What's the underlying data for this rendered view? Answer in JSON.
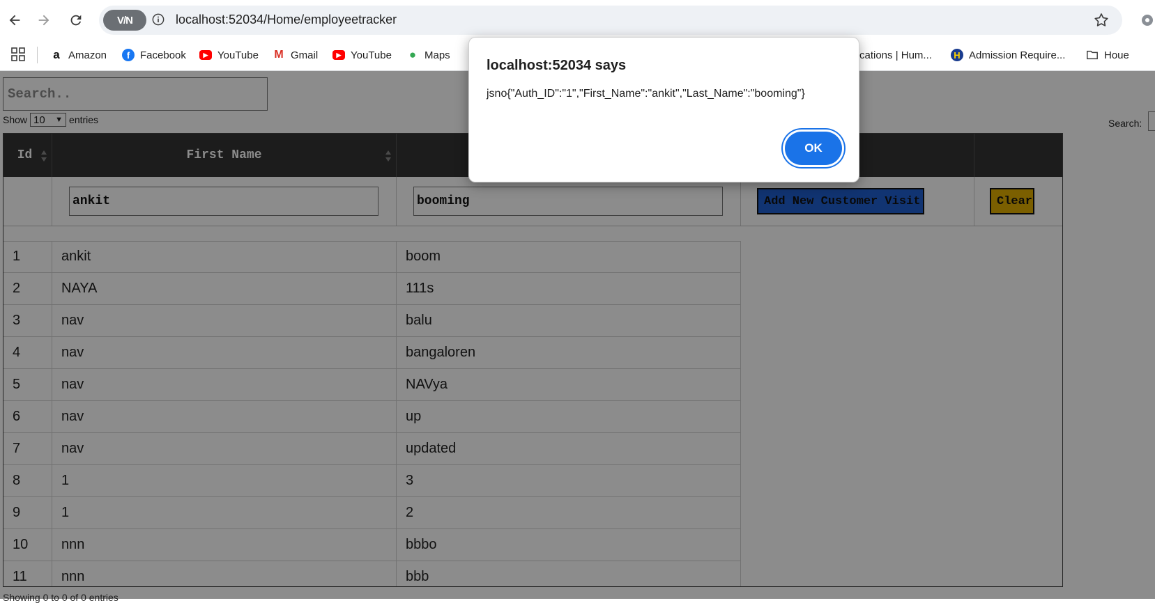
{
  "browser": {
    "vpn_label": "V/N",
    "url": "localhost:52034/Home/employeetracker"
  },
  "bookmarks": [
    {
      "label": "Amazon",
      "icon": "amazon-icon"
    },
    {
      "label": "Facebook",
      "icon": "facebook-icon"
    },
    {
      "label": "YouTube",
      "icon": "youtube-icon"
    },
    {
      "label": "Gmail",
      "icon": "gmail-icon"
    },
    {
      "label": "YouTube",
      "icon": "youtube-icon"
    },
    {
      "label": "Maps",
      "icon": "maps-icon"
    },
    {
      "label": "cations | Hum...",
      "icon": ""
    },
    {
      "label": "Admission Require...",
      "icon": "site-icon"
    },
    {
      "label": "Houe",
      "icon": "folder-icon"
    }
  ],
  "page": {
    "search_placeholder": "Search..",
    "show_label": "Show",
    "entries_value": "10",
    "entries_label": "entries",
    "dt_search_label": "Search:",
    "footer_info": "Showing 0 to 0 of 0 entries"
  },
  "table": {
    "headers": {
      "id": "Id",
      "first_name": "First Name"
    },
    "filter": {
      "first_name_value": "ankit",
      "last_name_value": "booming",
      "add_button": "Add New Customer Visit",
      "clear_button": "Clear"
    },
    "rows": [
      {
        "id": "1",
        "first": "ankit",
        "last": "boom"
      },
      {
        "id": "2",
        "first": "NAYA",
        "last": "111s"
      },
      {
        "id": "3",
        "first": "nav",
        "last": "balu"
      },
      {
        "id": "4",
        "first": "nav",
        "last": "bangaloren"
      },
      {
        "id": "5",
        "first": "nav",
        "last": "NAVya"
      },
      {
        "id": "6",
        "first": "nav",
        "last": "up"
      },
      {
        "id": "7",
        "first": "nav",
        "last": "updated"
      },
      {
        "id": "8",
        "first": "1",
        "last": "3"
      },
      {
        "id": "9",
        "first": "1",
        "last": "2"
      },
      {
        "id": "10",
        "first": "nnn",
        "last": "bbbo"
      },
      {
        "id": "11",
        "first": "nnn",
        "last": "bbb"
      }
    ]
  },
  "dialog": {
    "title": "localhost:52034 says",
    "message": "jsno{\"Auth_ID\":\"1\",\"First_Name\":\"ankit\",\"Last_Name\":\"booming\"}",
    "ok_label": "OK"
  },
  "colors": {
    "accent": "#1a73e8",
    "add_button": "#1f5fd0",
    "clear_button": "#e0ae00",
    "table_header": "#333333"
  }
}
